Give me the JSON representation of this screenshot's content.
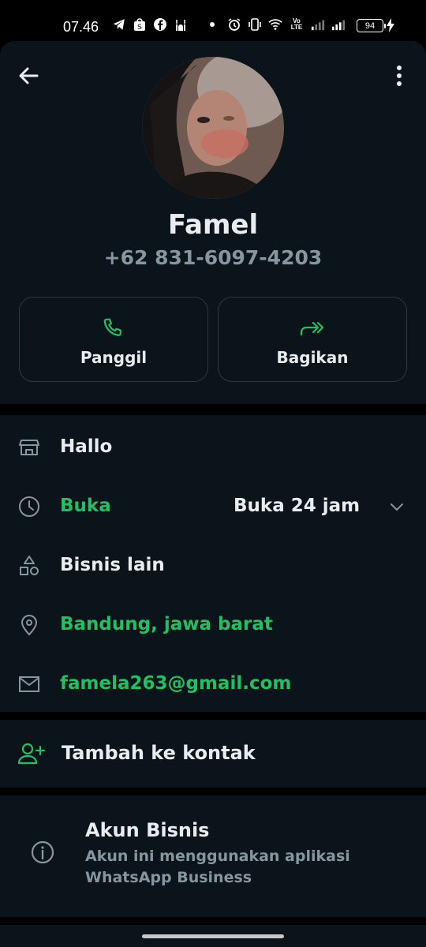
{
  "statusbar": {
    "time": "07.46",
    "battery": "94",
    "icons": [
      "telegram-icon",
      "shopee-icon",
      "facebook-icon",
      "mosque-icon",
      "dot-icon",
      "alarm-icon",
      "vibrate-icon",
      "wifi-icon",
      "volte-icon",
      "signal-icon",
      "signal-icon",
      "battery-icon",
      "charging-icon"
    ],
    "volte_text": "Vo LTE"
  },
  "header": {
    "back_icon": "arrow-back-icon",
    "menu_icon": "more-vert-icon"
  },
  "profile": {
    "name": "Famel",
    "phone": "+62 831-6097-4203"
  },
  "actions": [
    {
      "label": "Panggil",
      "icon": "phone-icon"
    },
    {
      "label": "Bagikan",
      "icon": "share-forward-icon"
    }
  ],
  "info": {
    "description": "Hallo",
    "hours_status": "Buka",
    "hours_detail": "Buka 24 jam",
    "category": "Bisnis lain",
    "address": "Bandung, jawa barat",
    "email": "famela263@gmail.com"
  },
  "add_contact": {
    "label": "Tambah ke kontak"
  },
  "business": {
    "title": "Akun Bisnis",
    "subtitle": "Akun ini menggunakan aplikasi WhatsApp Business"
  },
  "colors": {
    "accent": "#21c063",
    "background": "#0b141a",
    "text": "#e9edef",
    "muted": "#8696a0"
  }
}
